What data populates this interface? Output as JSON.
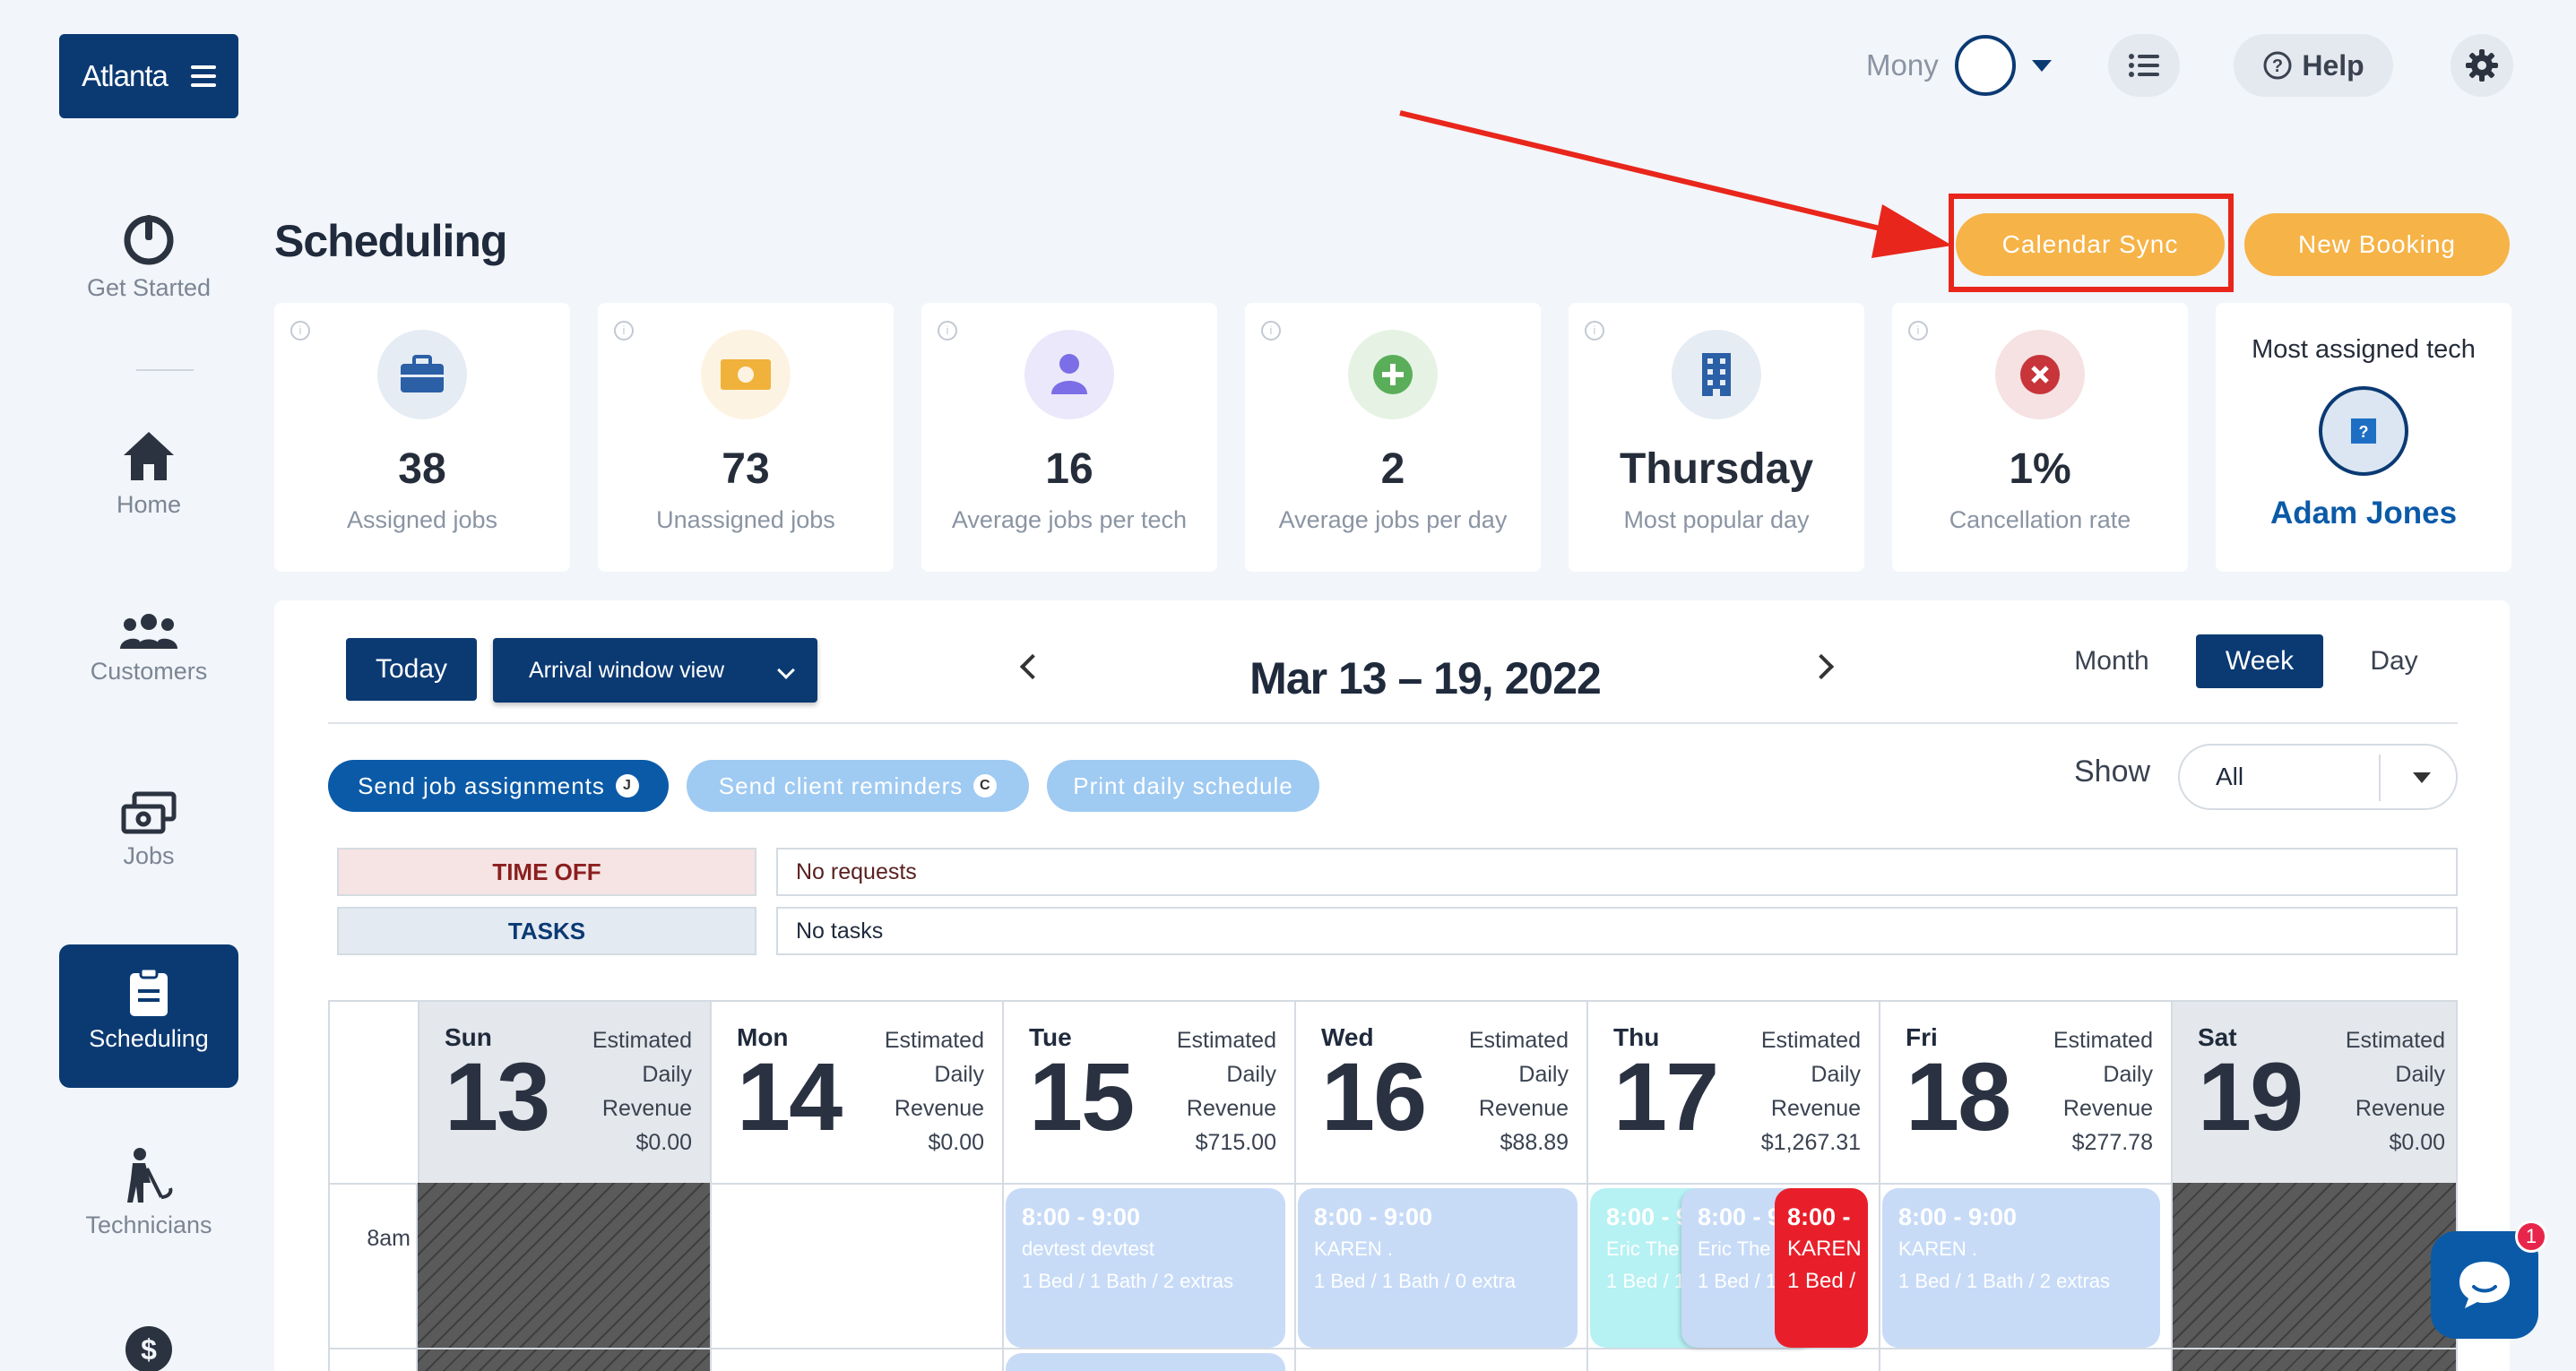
{
  "brand": {
    "label": "Atlanta"
  },
  "topbar": {
    "user_name": "Mony",
    "help_label": "Help"
  },
  "sidebar": {
    "items": [
      {
        "label": "Get Started",
        "icon": "power-icon"
      },
      {
        "label": "Home",
        "icon": "home-icon"
      },
      {
        "label": "Customers",
        "icon": "users-icon"
      },
      {
        "label": "Jobs",
        "icon": "money-stack-icon"
      },
      {
        "label": "Scheduling",
        "icon": "clipboard-icon",
        "active": true
      },
      {
        "label": "Technicians",
        "icon": "cleaner-icon"
      },
      {
        "label": "",
        "icon": "dollar-icon"
      }
    ]
  },
  "page": {
    "title": "Scheduling",
    "calendar_sync_label": "Calendar Sync",
    "new_booking_label": "New Booking"
  },
  "stats": [
    {
      "value": "38",
      "label": "Assigned jobs",
      "icon": "briefcase-icon",
      "color": "#2b5fa6",
      "bg": "#e6ecf4"
    },
    {
      "value": "73",
      "label": "Unassigned jobs",
      "icon": "cash-icon",
      "color": "#f0b23b",
      "bg": "#fdf3e2"
    },
    {
      "value": "16",
      "label": "Average jobs per tech",
      "icon": "person-icon",
      "color": "#7b6ee6",
      "bg": "#ebe8fb"
    },
    {
      "value": "2",
      "label": "Average jobs per day",
      "icon": "plus-circle-icon",
      "color": "#5aae5a",
      "bg": "#e6f3e4"
    },
    {
      "value": "Thursday",
      "label": "Most popular day",
      "icon": "building-icon",
      "color": "#2b5fa6",
      "bg": "#e6ecf4"
    },
    {
      "value": "1%",
      "label": "Cancellation rate",
      "icon": "x-circle-icon",
      "color": "#c7343a",
      "bg": "#f6e2e3"
    }
  ],
  "most_assigned": {
    "title": "Most assigned tech",
    "name": "Adam Jones"
  },
  "calendar": {
    "today_label": "Today",
    "view_select": "Arrival window view",
    "date_range": "Mar 13 – 19, 2022",
    "view_tabs": [
      "Month",
      "Week",
      "Day"
    ],
    "active_view": "Week",
    "chips": {
      "send_assignments": "Send job assignments",
      "send_reminders": "Send client reminders",
      "print_schedule": "Print daily schedule"
    },
    "show_label": "Show",
    "show_value": "All",
    "time_off": {
      "label": "TIME OFF",
      "value": "No requests"
    },
    "tasks": {
      "label": "TASKS",
      "value": "No tasks"
    },
    "revenue_label_lines": [
      "Estimated",
      "Daily",
      "Revenue"
    ],
    "days": [
      {
        "name": "Sun",
        "num": "13",
        "revenue": "$0.00"
      },
      {
        "name": "Mon",
        "num": "14",
        "revenue": "$0.00"
      },
      {
        "name": "Tue",
        "num": "15",
        "revenue": "$715.00"
      },
      {
        "name": "Wed",
        "num": "16",
        "revenue": "$88.89"
      },
      {
        "name": "Thu",
        "num": "17",
        "revenue": "$1,267.31"
      },
      {
        "name": "Fri",
        "num": "18",
        "revenue": "$277.78"
      },
      {
        "name": "Sat",
        "num": "19",
        "revenue": "$0.00"
      }
    ],
    "time_label": "8am",
    "events": {
      "tue": {
        "time": "8:00 - 9:00",
        "client": "devtest devtest",
        "details": "1 Bed / 1 Bath / 2 extras"
      },
      "wed": {
        "time": "8:00 - 9:00",
        "client": "KAREN .",
        "details": "1 Bed / 1 Bath / 0 extra"
      },
      "thu1": {
        "time": "8:00 - 9",
        "client": "Eric The /",
        "details": "1 Bed / 1"
      },
      "thu2": {
        "time": "8:00 - 9",
        "client": "Eric The /",
        "details": "1 Bed / 1"
      },
      "thu3": {
        "time": "8:00 -",
        "client": "KAREN",
        "details": "1 Bed /"
      },
      "fri": {
        "time": "8:00 - 9:00",
        "client": "KAREN .",
        "details": "1 Bed / 1 Bath / 2 extras"
      }
    }
  },
  "chat_badge": "1"
}
